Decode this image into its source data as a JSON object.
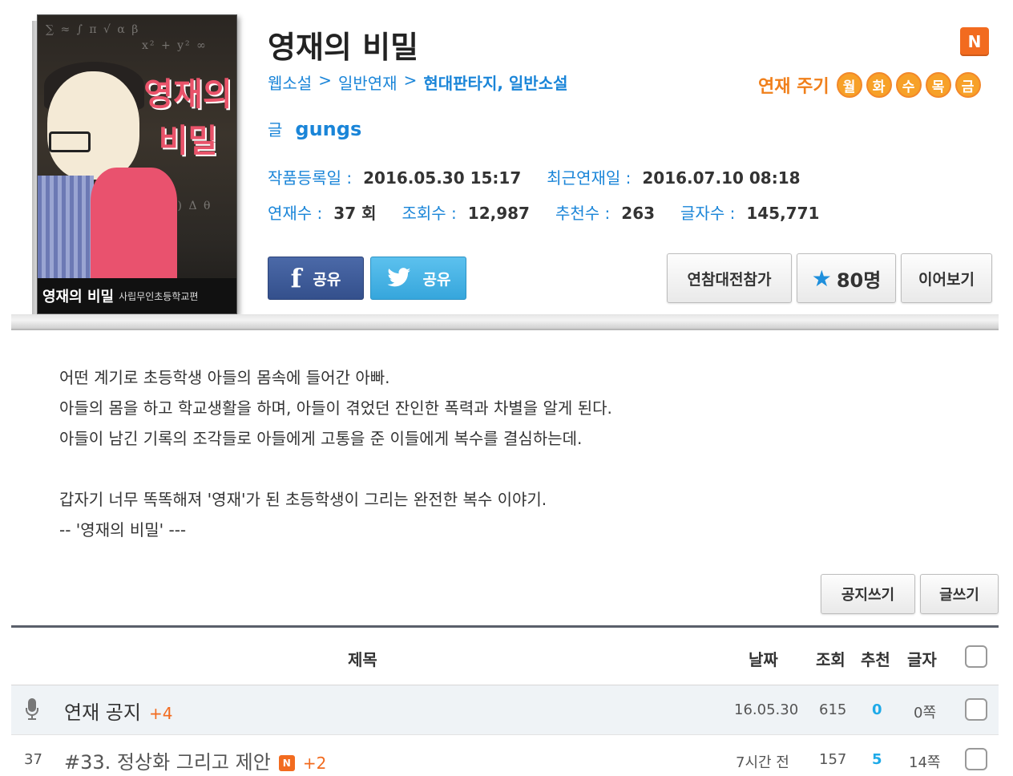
{
  "cover": {
    "title_big_1": "영재의",
    "title_big_2": "비밀",
    "banner_title": "영재의 비밀",
    "banner_sub": "사립무인초등학교편"
  },
  "work": {
    "title": "영재의 비밀",
    "breadcrumb": [
      "웹소설",
      "일반연재",
      "현대판타지, 일반소설"
    ],
    "author_label": "글",
    "author_name": "gungs",
    "registered_label": "작품등록일 :",
    "registered": "2016.05.30 15:17",
    "updated_label": "최근연재일 :",
    "updated": "2016.07.10 08:18",
    "episodes_label": "연재수 :",
    "episodes": "37 회",
    "views_label": "조회수 :",
    "views": "12,987",
    "recommends_label": "추천수 :",
    "recommends": "263",
    "chars_label": "글자수 :",
    "chars": "145,771"
  },
  "badge": {
    "new": "N"
  },
  "cycle": {
    "label": "연재 주기",
    "days": [
      "월",
      "화",
      "수",
      "목",
      "금"
    ]
  },
  "share": {
    "facebook_glyph": "f",
    "facebook_label": "공유",
    "twitter_label": "공유"
  },
  "actions": {
    "battle": "연참대전참가",
    "favorites": "80명",
    "continue": "이어보기",
    "notice_write": "공지쓰기",
    "write": "글쓰기"
  },
  "description": {
    "lines_a": [
      "어떤 계기로 초등학생 아들의 몸속에 들어간 아빠.",
      "아들의 몸을 하고 학교생활을 하며, 아들이 겪었던 잔인한 폭력과 차별을 알게 된다.",
      "아들이 남긴 기록의 조각들로 아들에게 고통을 준 이들에게 복수를 결심하는데."
    ],
    "lines_b": [
      "갑자기 너무 똑똑해져 '영재'가 된 초등학생이 그리는 완전한 복수 이야기.",
      "-- '영재의 비밀' ---"
    ]
  },
  "list": {
    "headers": {
      "title": "제목",
      "date": "날짜",
      "views": "조회",
      "recommend": "추천",
      "chars": "글자"
    },
    "notice": {
      "title": "연재 공지",
      "plus": "+4",
      "date": "16.05.30",
      "views": "615",
      "recommend": "0",
      "chars": "0쪽"
    },
    "rows": [
      {
        "no": "37",
        "title": "#33. 정상화 그리고 제안",
        "badge": "N",
        "plus": "+2",
        "date": "7시간 전",
        "views": "157",
        "recommend": "5",
        "chars": "14쪽"
      }
    ]
  }
}
